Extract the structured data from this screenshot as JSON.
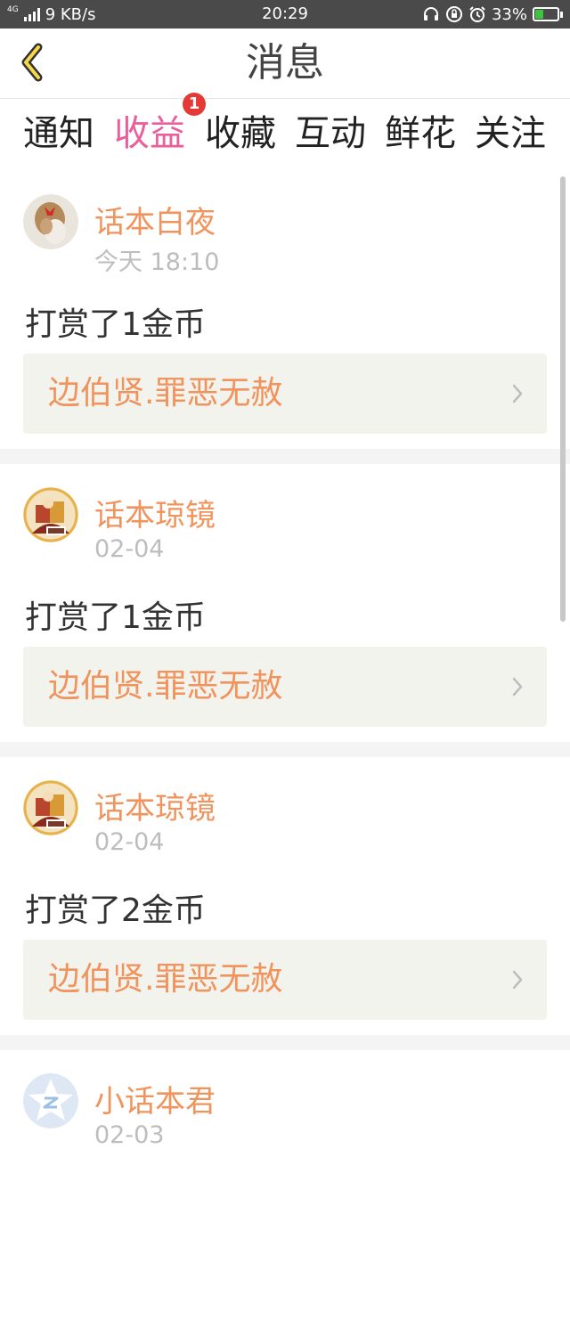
{
  "status_bar": {
    "network_tag": "4G",
    "speed": "9 KB/s",
    "time": "20:29",
    "battery": "33%",
    "battery_level": 0.33
  },
  "header": {
    "title": "消息",
    "back_icon": "chevron-left-icon"
  },
  "tabs": [
    {
      "label": "通知",
      "active": false
    },
    {
      "label": "收益",
      "active": true,
      "badge": "1"
    },
    {
      "label": "收藏",
      "active": false
    },
    {
      "label": "互动",
      "active": false
    },
    {
      "label": "鲜花",
      "active": false
    },
    {
      "label": "关注",
      "active": false
    }
  ],
  "colors": {
    "accent": "#ea5f9b",
    "username": "#f0935c",
    "badge": "#e53935"
  },
  "feed": [
    {
      "user": "话本白夜",
      "time": "今天 18:10",
      "message": "打赏了1金币",
      "book": "边伯贤.罪恶无赦",
      "avatar_icon": "girl-avatar"
    },
    {
      "user": "话本琼镜",
      "time": "02-04",
      "message": "打赏了1金币",
      "book": "边伯贤.罪恶无赦",
      "avatar_icon": "qiongjing-avatar"
    },
    {
      "user": "话本琼镜",
      "time": "02-04",
      "message": "打赏了2金币",
      "book": "边伯贤.罪恶无赦",
      "avatar_icon": "qiongjing-avatar"
    },
    {
      "user": "小话本君",
      "time": "02-03",
      "avatar_icon": "star-z-avatar"
    }
  ]
}
